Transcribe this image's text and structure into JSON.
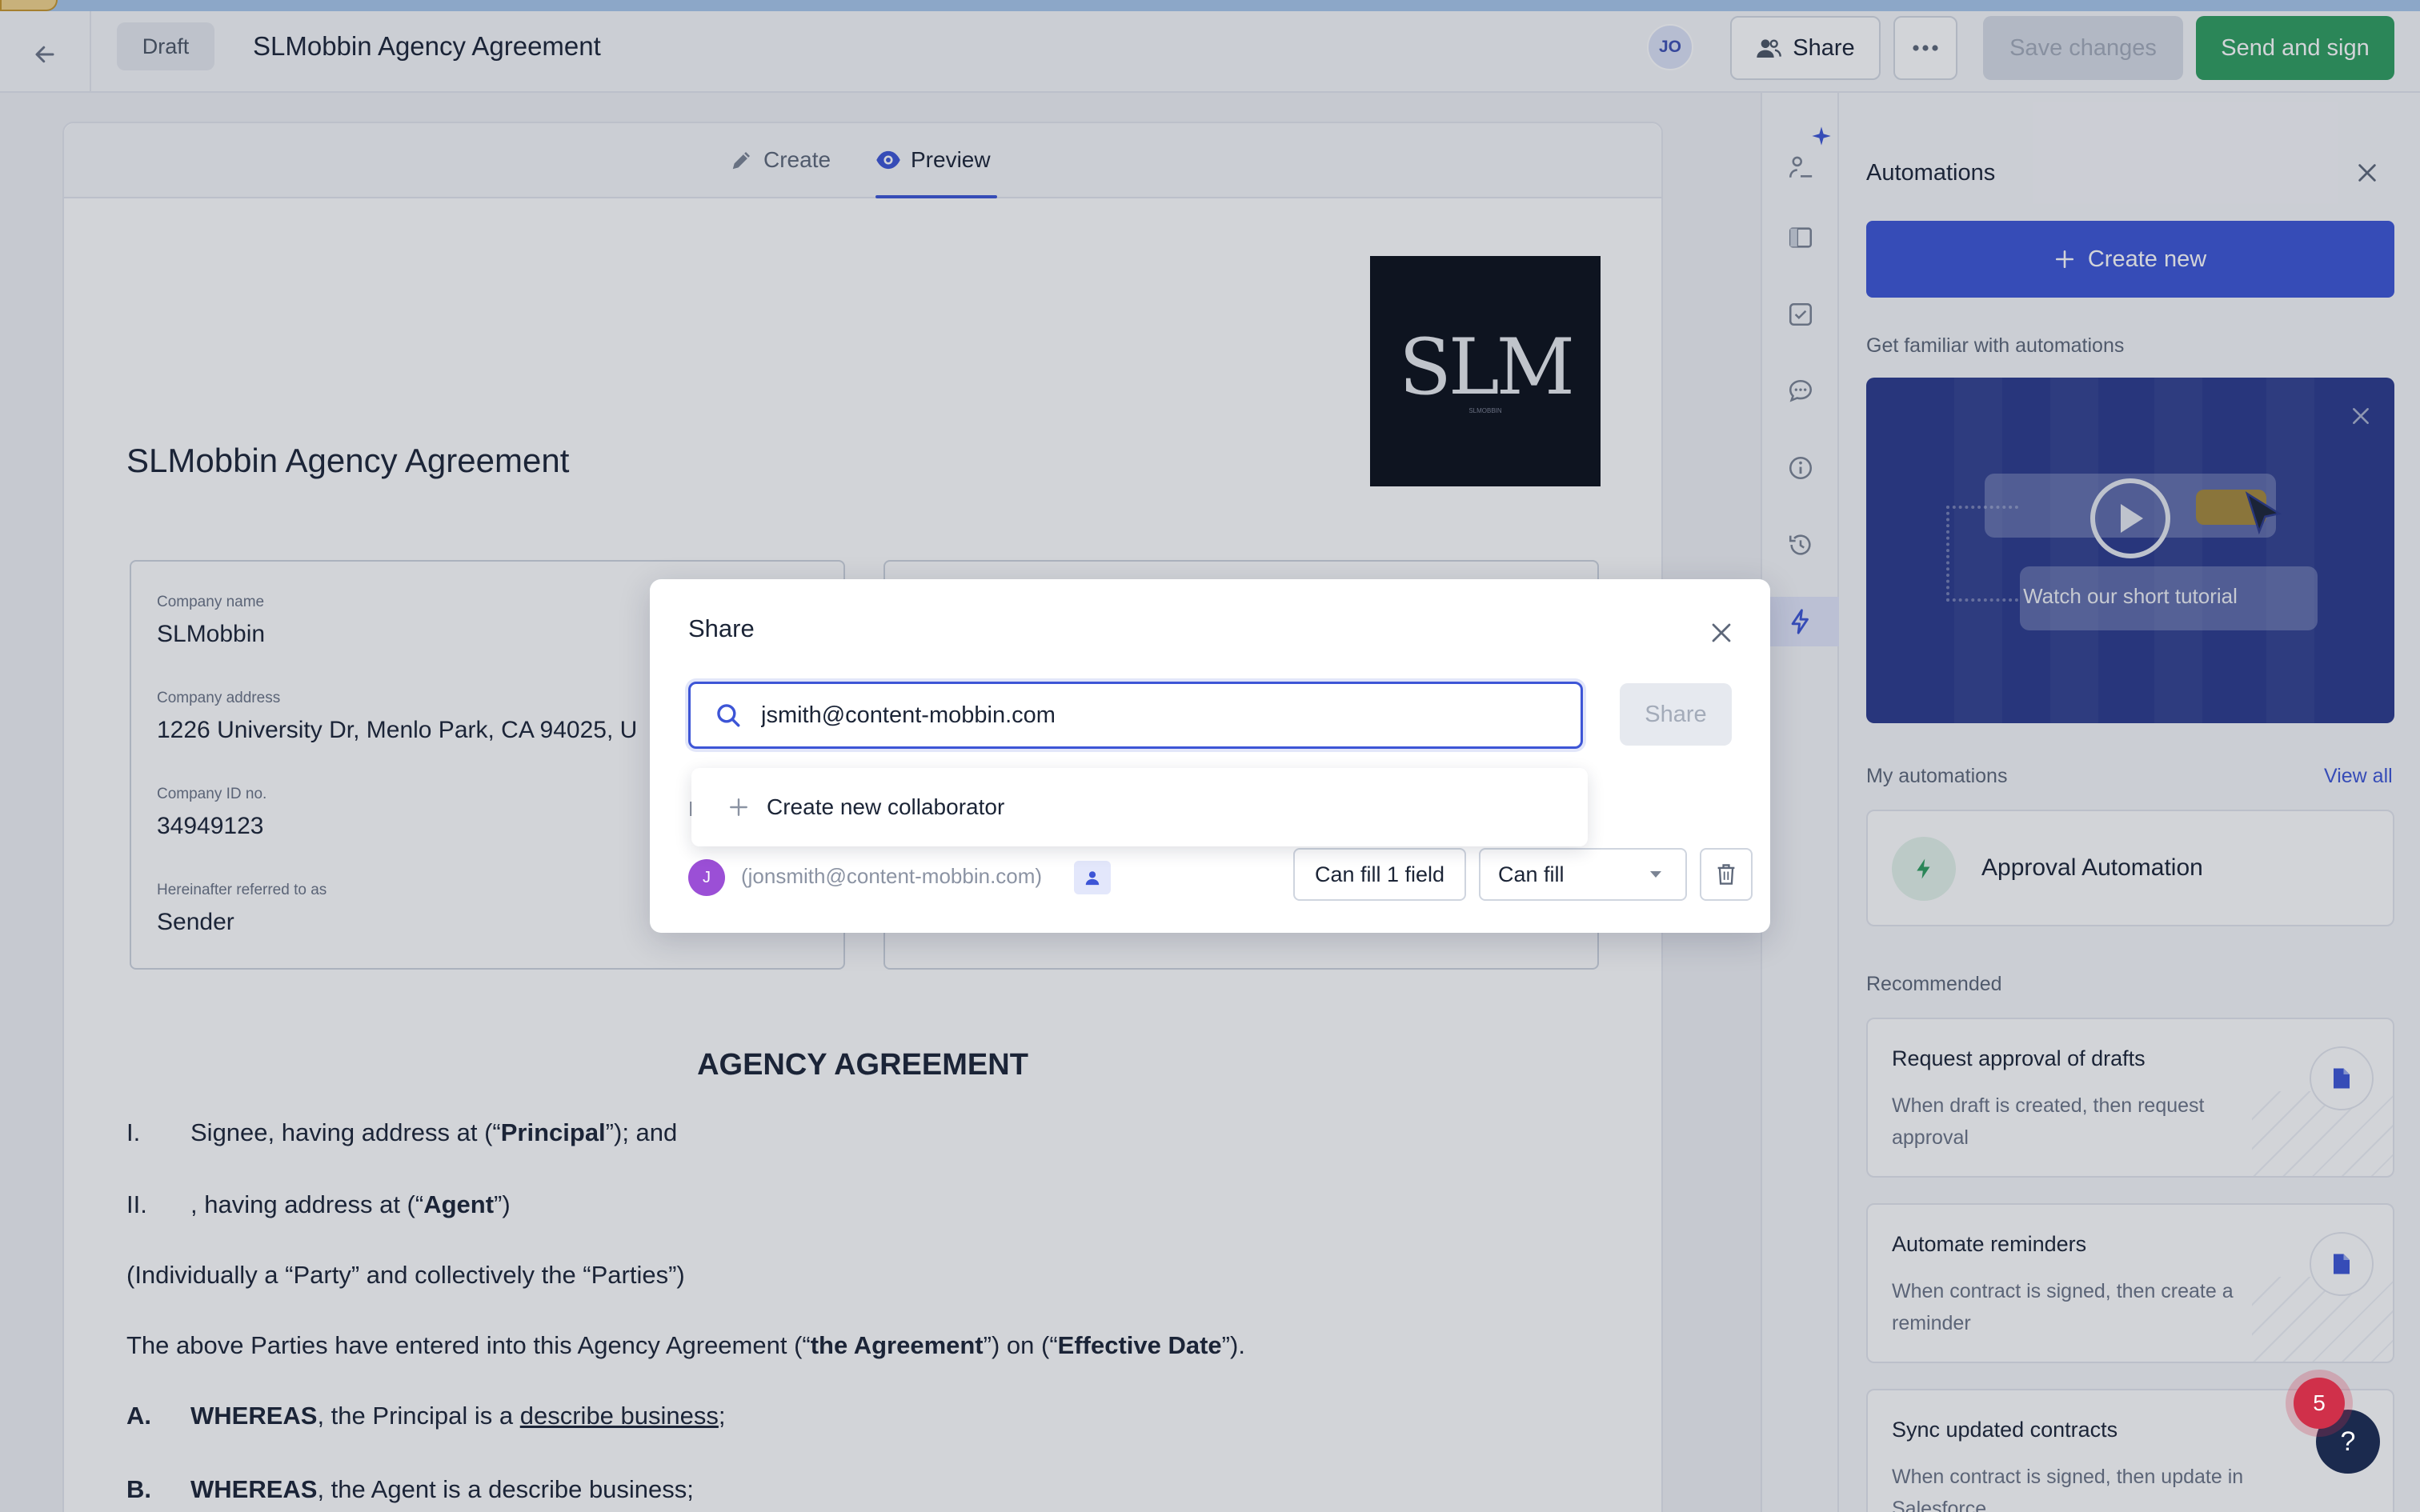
{
  "header": {
    "status_badge": "Draft",
    "title": "SLMobbin Agency Agreement",
    "avatar_initials": "JO",
    "share_label": "Share",
    "save_label": "Save changes",
    "send_label": "Send and sign"
  },
  "tabs": [
    {
      "label": "Create",
      "icon": "pencil-icon",
      "active": false
    },
    {
      "label": "Preview",
      "icon": "eye-icon",
      "active": true
    }
  ],
  "document": {
    "logo_text": "SLM",
    "logo_subtext": "SLMOBBIN",
    "heading": "SLMobbin Agency Agreement",
    "party_left": {
      "company_name_label": "Company name",
      "company_name": "SLMobbin",
      "company_address_label": "Company address",
      "company_address": "1226 University Dr, Menlo Park, CA 94025, U",
      "company_id_label": "Company ID no.",
      "company_id": "34949123",
      "referred_label": "Hereinafter referred to as",
      "referred": "Sender"
    },
    "section_title": "AGENCY AGREEMENT",
    "clauses": {
      "c1_num": "I.",
      "c1_a": "Signee, having address at  (“",
      "c1_b": "Principal",
      "c1_c": "”); and",
      "c2_num": "II.",
      "c2_a": ", having address at  (“",
      "c2_b": "Agent",
      "c2_c": "”)",
      "c3": "(Individually a “Party” and collectively the “Parties”)",
      "c4_a": "The above Parties have entered into this Agency Agreement (“",
      "c4_b": "the Agreement",
      "c4_c": "”) on  (“",
      "c4_d": "Effective Date",
      "c4_e": "”).",
      "cA_num": "A.",
      "cA_b": "WHEREAS",
      "cA_a": ", the Principal is a ",
      "cA_u": "describe business",
      "cA_c": ";",
      "cB_num": "B.",
      "cB_b": "WHEREAS",
      "cB_a": ", the Agent is a describe business;"
    }
  },
  "rail_icons": [
    "sparkle-icon",
    "signature-icon",
    "compare-icon",
    "checkbox-icon",
    "comment-icon",
    "info-icon",
    "history-icon",
    "lightning-icon"
  ],
  "automations": {
    "title": "Automations",
    "create_new_label": "Create new",
    "familiar_label": "Get familiar with automations",
    "tutorial_caption": "Watch our short tutorial",
    "my_automations_label": "My automations",
    "view_all_label": "View all",
    "my_items": [
      {
        "name": "Approval Automation"
      }
    ],
    "recommended_label": "Recommended",
    "recommended": [
      {
        "title": "Request approval of drafts",
        "desc": "When draft is created, then request approval"
      },
      {
        "title": "Automate reminders",
        "desc": "When contract is signed, then create a reminder"
      },
      {
        "title": "Sync updated contracts",
        "desc": "When contract is signed, then update in Salesforce"
      }
    ],
    "help_badge_count": "5",
    "help_label": "?"
  },
  "share_modal": {
    "title": "Share",
    "search_value": "jsmith@content-mobbin.com",
    "share_button_label": "Share",
    "create_collaborator_label": "Create new collaborator",
    "peek_char": "I",
    "collaborator": {
      "avatar_initial": "J",
      "email": "(jonsmith@content-mobbin.com)",
      "fields_label": "Can fill 1 field",
      "permission": "Can fill"
    }
  },
  "colors": {
    "accent": "#3d55d6",
    "send_green": "#2f9e5f",
    "tutorial_bg": "#2b3a8c",
    "badge_red": "#d0304a"
  }
}
